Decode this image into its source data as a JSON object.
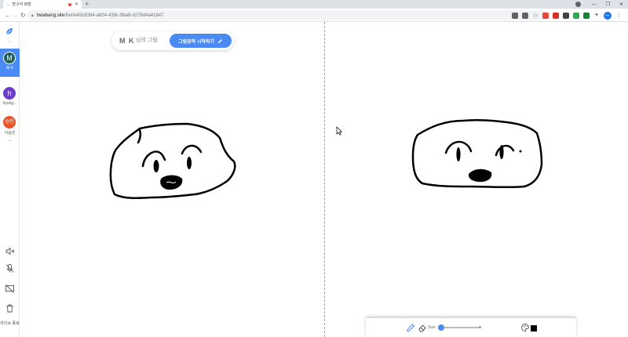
{
  "browser": {
    "tab_title": "방구석 화방",
    "url_host": "hwabang.site",
    "url_path": "/live/e43c8394-ab04-439c-9ba6-d279d4a41847",
    "profile_initials": "HY"
  },
  "sidebar": {
    "users": [
      {
        "initial": "M",
        "name": "M K",
        "color": "#1f5f5a",
        "active": true
      },
      {
        "initial": "h",
        "name": "hyung...",
        "color": "#6a3cc9",
        "active": false
      },
      {
        "initial": "승민",
        "name": "이승민",
        "color": "#e8552b",
        "active": false
      }
    ],
    "end_live_label": "라이브 종료"
  },
  "header": {
    "user_name": "M K",
    "user_suffix": "님의 그림",
    "start_button_label": "그림장작 시작하기"
  },
  "tools": {
    "size_label": "Size",
    "size_value": 0.06,
    "active_tool": "pen",
    "color": "#000000"
  },
  "colors": {
    "accent": "#4a8af4"
  }
}
